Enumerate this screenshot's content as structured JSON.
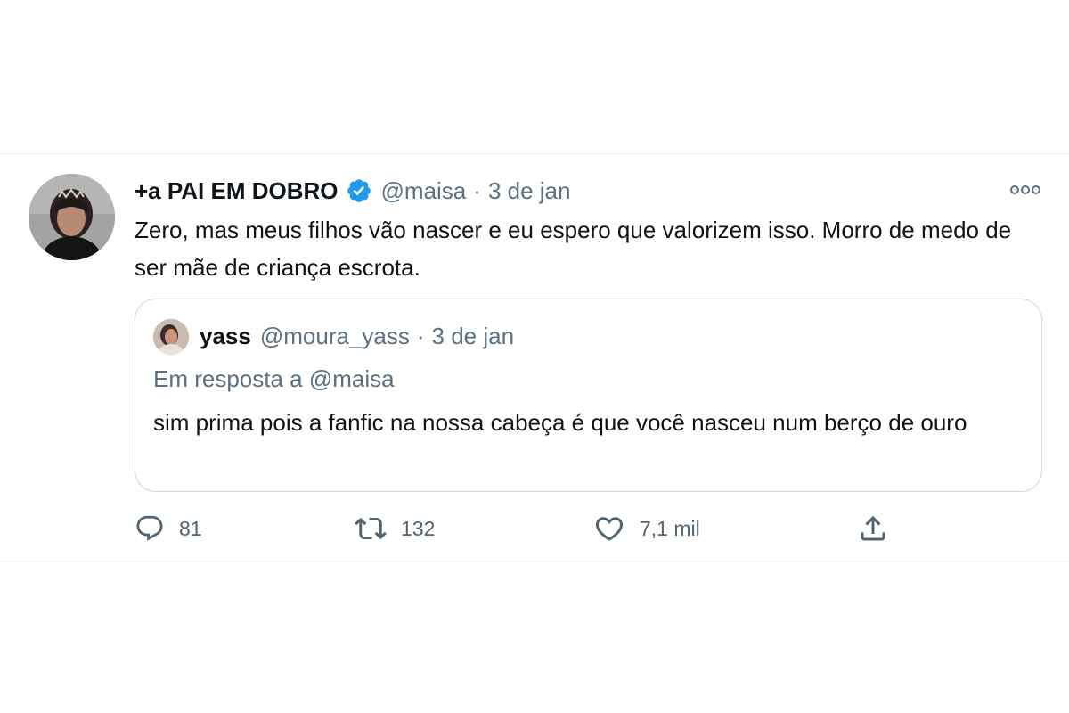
{
  "tweet": {
    "display_name": "+a PAI EM DOBRO",
    "handle": "@maisa",
    "separator": "·",
    "date": "3 de jan",
    "text": "Zero, mas meus filhos vão nascer e eu espero que valorizem isso. Morro de medo de ser mãe de criança escrota.",
    "verified_icon": "verified-badge-icon",
    "more_icon": "more-options-icon",
    "colors": {
      "verified": "#1d9bf0",
      "secondary_text": "#5b7083",
      "primary_text": "#0f1419",
      "border": "#cfd9de"
    }
  },
  "quoted_tweet": {
    "display_name": "yass",
    "handle": "@moura_yass",
    "separator": "·",
    "date": "3 de jan",
    "reply_prefix": "Em resposta a",
    "reply_handle": "@maisa",
    "text": "sim prima pois a fanfic na nossa cabeça é que você nasceu num berço de ouro"
  },
  "actions": {
    "reply": {
      "icon": "reply-icon",
      "count": "81"
    },
    "retweet": {
      "icon": "retweet-icon",
      "count": "132"
    },
    "like": {
      "icon": "like-icon",
      "count": "7,1 mil"
    },
    "share": {
      "icon": "share-icon"
    }
  }
}
